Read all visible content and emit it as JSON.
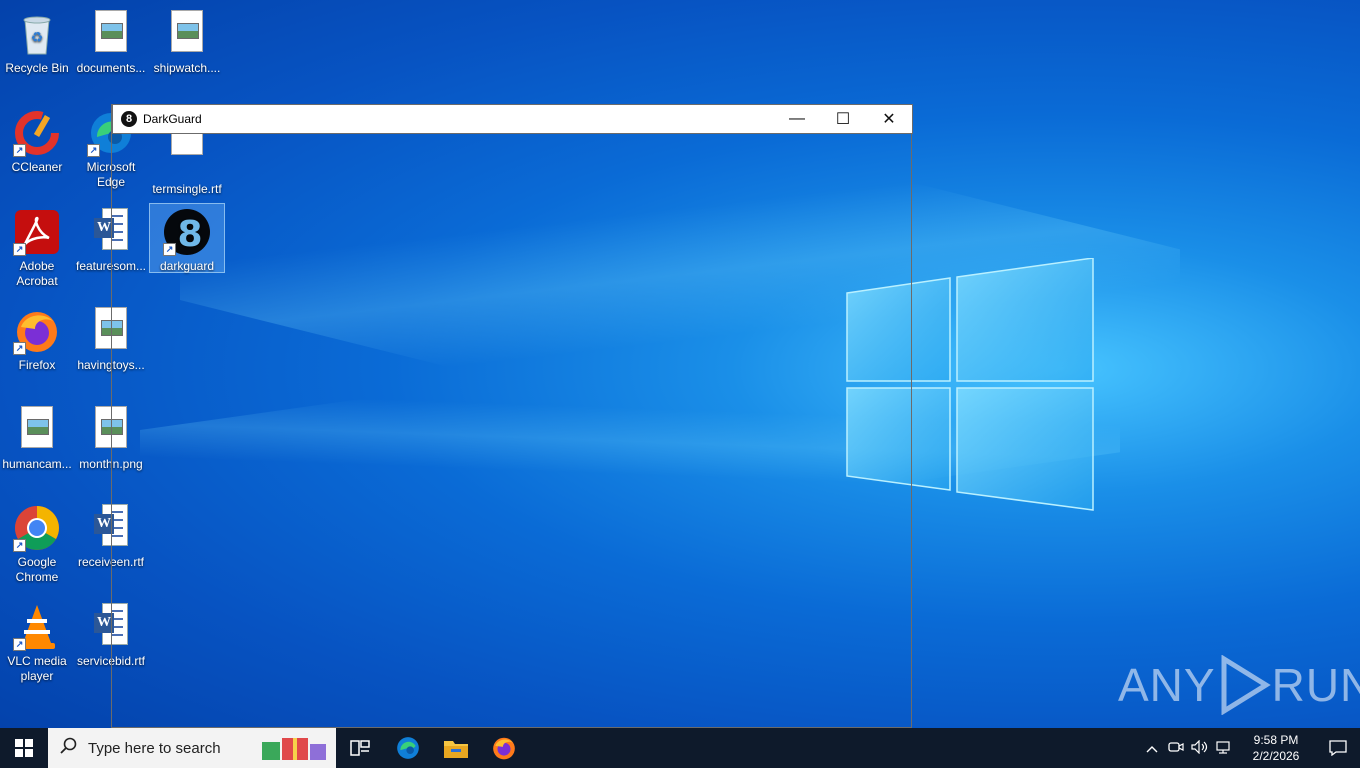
{
  "desktop": {
    "icons": [
      {
        "label": "Recycle Bin"
      },
      {
        "label": "documents..."
      },
      {
        "label": "shipwatch...."
      },
      {
        "label": "CCleaner"
      },
      {
        "label": "Microsoft Edge"
      },
      {
        "label": "termsingle.rtf"
      },
      {
        "label": "Adobe Acrobat"
      },
      {
        "label": "featuresom..."
      },
      {
        "label": "darkguard"
      },
      {
        "label": "Firefox"
      },
      {
        "label": "havingtoys..."
      },
      {
        "label": "humancam..."
      },
      {
        "label": "monthn.png"
      },
      {
        "label": "Google Chrome"
      },
      {
        "label": "receiveen.rtf"
      },
      {
        "label": "VLC media player"
      },
      {
        "label": "servicebid.rtf"
      }
    ]
  },
  "window": {
    "title": "DarkGuard",
    "minimize": "—",
    "maximize": "☐",
    "close": "✕"
  },
  "taskbar": {
    "search_placeholder": "Type here to search",
    "clock_time": "9:58 PM",
    "clock_date": "2/2/2026"
  },
  "watermark": {
    "left": "ANY",
    "right": "RUN"
  },
  "colors": {
    "taskbar": "#0e1a2b",
    "desktop_accent": "#0a6bd6"
  }
}
